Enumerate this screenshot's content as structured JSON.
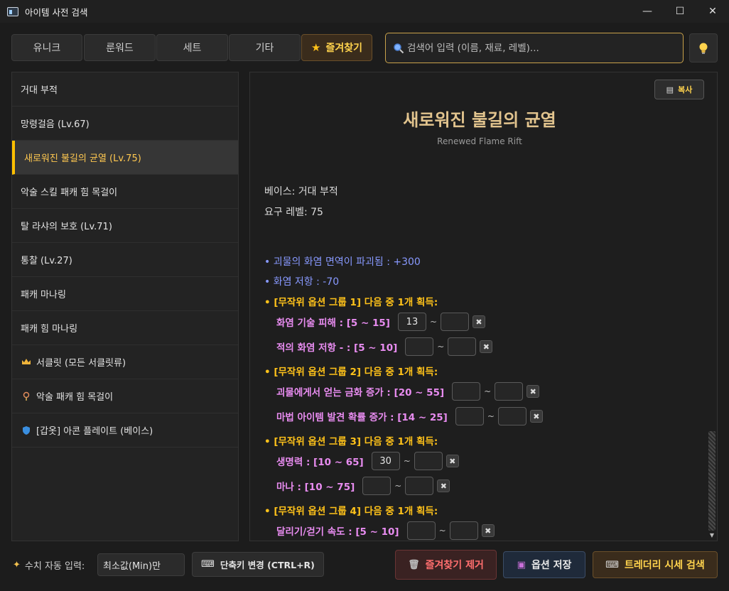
{
  "window": {
    "title": "아이템 사전 검색",
    "minimize": "—",
    "maximize": "☐",
    "close": "✕"
  },
  "tabs": [
    {
      "label": "유니크"
    },
    {
      "label": "룬워드"
    },
    {
      "label": "세트"
    },
    {
      "label": "기타"
    },
    {
      "label": "즐겨찾기",
      "icon": "star-icon"
    }
  ],
  "search": {
    "placeholder": "검색어 입력 (이름, 재료, 레벨)...",
    "value": ""
  },
  "hint_button": {
    "icon": "lightbulb-icon"
  },
  "sidebar": {
    "items": [
      {
        "label": "거대 부적"
      },
      {
        "label": "망령걸음 (Lv.67)"
      },
      {
        "label": "새로워진 불길의 균열 (Lv.75)",
        "selected": true
      },
      {
        "label": "악술 스킬 패캐 힘 목걸이"
      },
      {
        "label": "탈 라샤의 보호 (Lv.71)"
      },
      {
        "label": "통찰 (Lv.27)"
      },
      {
        "label": "패캐 마나링"
      },
      {
        "label": "패캐 힘 마나링"
      },
      {
        "label": "서클릿 (모든 서클릿류)",
        "icon": "crown-icon"
      },
      {
        "label": "악술 패캐 힘 목걸이",
        "icon": "amulet-icon"
      },
      {
        "label": "[갑옷] 아콘 플레이트 (베이스)",
        "icon": "shield-icon"
      }
    ]
  },
  "detail": {
    "copy_label": "복사",
    "title": "새로워진 불길의 균열",
    "subtitle": "Renewed Flame Rift",
    "base": "베이스: 거대 부적",
    "req_level": "요구 레벨: 75",
    "fixed_mods": [
      "• 괴물의 화염 면역이 파괴됨 : +300",
      "• 화염 저항 : -70"
    ],
    "groups": [
      {
        "header": "• [무작위 옵션 그룹 1] 다음 중 1개 획득:",
        "options": [
          {
            "label": "화염 기술 피해 : [5 ~ 15]",
            "min": "13",
            "max": ""
          },
          {
            "label": "적의 화염 저항 - : [5 ~ 10]",
            "min": "",
            "max": ""
          }
        ]
      },
      {
        "header": "• [무작위 옵션 그룹 2] 다음 중 1개 획득:",
        "options": [
          {
            "label": "괴물에게서 얻는 금화 증가 : [20 ~ 55]",
            "min": "",
            "max": ""
          },
          {
            "label": "마법 아이템 발견 확률 증가 : [14 ~ 25]",
            "min": "",
            "max": ""
          }
        ]
      },
      {
        "header": "• [무작위 옵션 그룹 3] 다음 중 1개 획득:",
        "options": [
          {
            "label": "생명력 : [10 ~ 65]",
            "min": "30",
            "max": ""
          },
          {
            "label": "마나 : [10 ~ 75]",
            "min": "",
            "max": ""
          }
        ]
      },
      {
        "header": "• [무작위 옵션 그룹 4] 다음 중 1개 획득:",
        "options": [
          {
            "label": "달리기/걷기 속도 : [5 ~ 10]",
            "min": "",
            "max": ""
          }
        ]
      }
    ],
    "range_sep": "~",
    "clear_glyph": "✖"
  },
  "bottom": {
    "auto_label": "수치 자동 입력:",
    "auto_value": "최소값(Min)만",
    "shortcut_label": "단축키 변경 (CTRL+R)",
    "remove_fav_label": "즐겨찾기 제거",
    "save_label": "옵션 저장",
    "trade_label": "트레더리 시세 검색"
  },
  "colors": {
    "accent_gold": "#ffc21a",
    "mod_blue": "#8899ff",
    "option_pink": "#e88cf0",
    "title_tan": "#e2c48e",
    "remove_red": "#ff6e6e"
  }
}
